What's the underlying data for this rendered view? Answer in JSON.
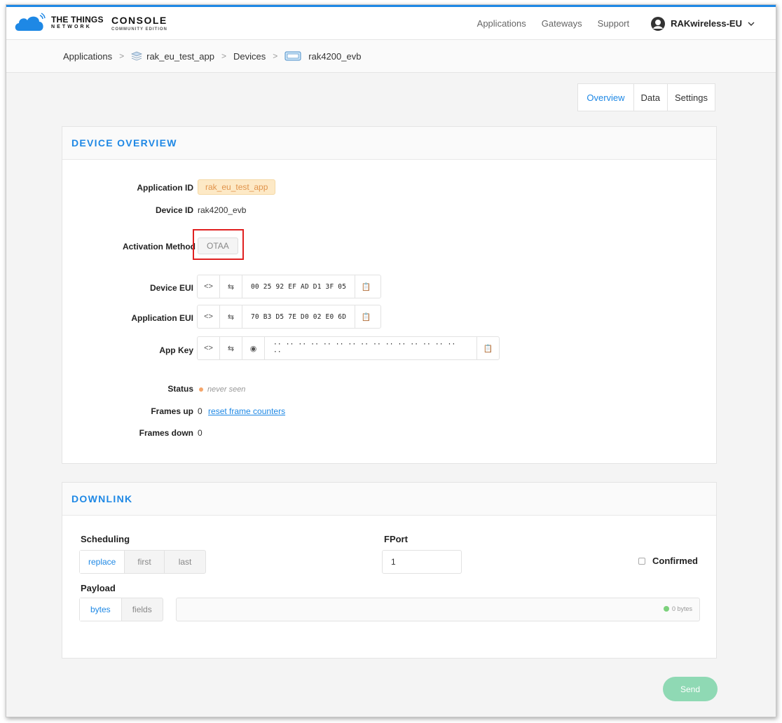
{
  "header": {
    "logo_line1": "THE THINGS",
    "logo_line2": "NETWORK",
    "logo_console": "CONSOLE",
    "logo_edition": "COMMUNITY EDITION",
    "nav": [
      "Applications",
      "Gateways",
      "Support"
    ],
    "user": "RAKwireless-EU"
  },
  "breadcrumb": {
    "items": [
      "Applications",
      "rak_eu_test_app",
      "Devices",
      "rak4200_evb"
    ]
  },
  "tabs": [
    "Overview",
    "Data",
    "Settings"
  ],
  "device_overview": {
    "title": "DEVICE OVERVIEW",
    "application_id_label": "Application ID",
    "application_id": "rak_eu_test_app",
    "device_id_label": "Device ID",
    "device_id": "rak4200_evb",
    "activation_label": "Activation Method",
    "activation": "OTAA",
    "device_eui_label": "Device EUI",
    "device_eui": "00 25 92 EF AD D1 3F 05",
    "app_eui_label": "Application EUI",
    "app_eui": "70 B3 D5 7E D0 02 E0 6D",
    "app_key_label": "App Key",
    "app_key": "·· ·· ·· ·· ·· ·· ·· ·· ·· ·· ·· ·· ·· ·· ·· ··",
    "status_label": "Status",
    "status": "never seen",
    "frames_up_label": "Frames up",
    "frames_up": "0",
    "reset_link": "reset frame counters",
    "frames_down_label": "Frames down",
    "frames_down": "0"
  },
  "downlink": {
    "title": "DOWNLINK",
    "scheduling_label": "Scheduling",
    "scheduling_options": [
      "replace",
      "first",
      "last"
    ],
    "fport_label": "FPort",
    "fport": "1",
    "confirmed_label": "Confirmed",
    "payload_label": "Payload",
    "payload_options": [
      "bytes",
      "fields"
    ],
    "payload_size": "0 bytes",
    "send_label": "Send"
  },
  "colors": {
    "accent": "#1e88e5",
    "highlight_box": "#e02020",
    "send_button": "#8fd9b4",
    "status_dot": "#f4a56a"
  }
}
